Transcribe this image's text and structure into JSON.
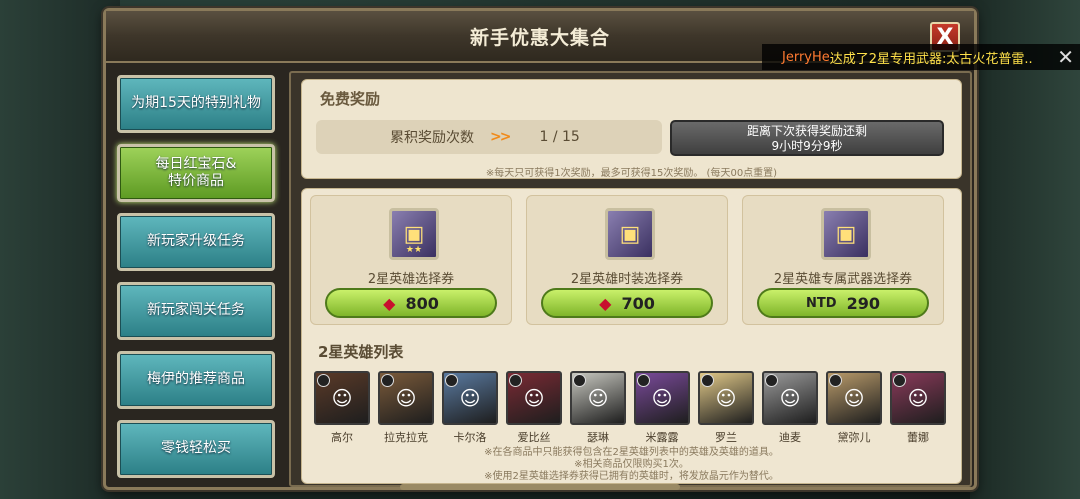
{
  "window": {
    "title": "新手优惠大集合",
    "close_label": "X"
  },
  "notice": {
    "player": "JerryHe",
    "message": "达成了2星专用武器:太古火花普雷..",
    "close_label": "✕"
  },
  "sidebar": {
    "items": [
      {
        "label": "为期15天的特别礼物",
        "active": false
      },
      {
        "label": "每日红宝石&\n特价商品",
        "active": true
      },
      {
        "label": "新玩家升级任务",
        "active": false
      },
      {
        "label": "新玩家闯关任务",
        "active": false
      },
      {
        "label": "梅伊的推荐商品",
        "active": false
      },
      {
        "label": "零钱轻松买",
        "active": false
      }
    ]
  },
  "free_reward": {
    "heading": "免费奖励",
    "count_label": "累积奖励次数",
    "count_arrows": ">>",
    "count_value": "1 / 15",
    "timer_line1": "距离下次获得奖励还剩",
    "timer_line2": "9小时9分9秒",
    "note": "※每天只可获得1次奖励，最多可获得15次奖励。 (每天00点重置)"
  },
  "shop": {
    "cards": [
      {
        "name": "2星英雄选择券",
        "currency_icon": "ruby-icon",
        "price": "800"
      },
      {
        "name": "2星英雄时装选择券",
        "currency_icon": "ruby-icon",
        "price": "700"
      },
      {
        "name": "2星英雄专属武器选择券",
        "currency": "NTD",
        "price": "290"
      }
    ]
  },
  "heroes": {
    "heading": "2星英雄列表",
    "list": [
      {
        "name": "高尔",
        "color": "#5a3a28"
      },
      {
        "name": "拉克拉克",
        "color": "#7a5a3a"
      },
      {
        "name": "卡尔洛",
        "color": "#5a7aa0"
      },
      {
        "name": "爱比丝",
        "color": "#7a2a34"
      },
      {
        "name": "瑟琳",
        "color": "#c8c8c0"
      },
      {
        "name": "米露露",
        "color": "#7a4a9a"
      },
      {
        "name": "罗兰",
        "color": "#e0c888"
      },
      {
        "name": "迪麦",
        "color": "#9a9a9a"
      },
      {
        "name": "黛弥儿",
        "color": "#b89a6a"
      },
      {
        "name": "蕾娜",
        "color": "#8a3a5a"
      }
    ],
    "notes": [
      "※在各商品中只能获得包含在2星英雄列表中的英雄及英雄的道具。",
      "※相关商品仅限购买1次。",
      "※使用2星英雄选择券获得已拥有的英雄时，将发放晶元作为替代。"
    ]
  }
}
